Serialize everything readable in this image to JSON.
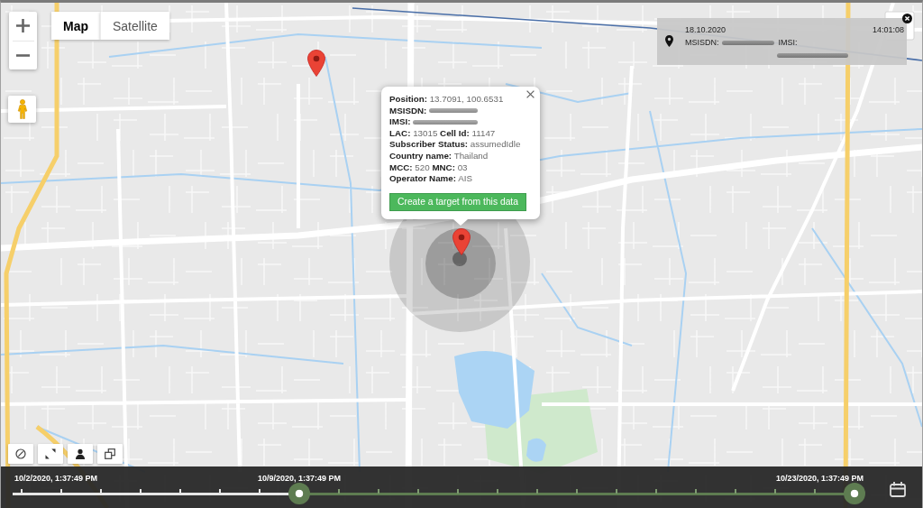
{
  "map": {
    "type_toggle": [
      {
        "label": "Map",
        "selected": true
      },
      {
        "label": "Satellite",
        "selected": false
      }
    ]
  },
  "popup": {
    "lines": [
      {
        "text": "**Position:** 13.7091, 100.6531",
        "redacted": false
      },
      {
        "text": "**MSISDN:**",
        "redacted": true
      },
      {
        "text": "**IMSI:**",
        "redacted": true
      },
      {
        "text": "**LAC:** 13015 **Cell Id:** 11147",
        "redacted": false
      },
      {
        "text": "**Subscriber Status:** assumedIdle",
        "redacted": false
      },
      {
        "text": "**Country name:** Thailand",
        "redacted": false
      },
      {
        "text": "**MCC:** 520 **MNC:** 03",
        "redacted": false
      },
      {
        "text": "**Operator Name:** AIS",
        "redacted": false
      }
    ],
    "button": "Create a target from this data"
  },
  "device_panel": {
    "date": "18.10.2020",
    "time": "14:01:08",
    "fields": [
      {
        "label": "MSISDN:",
        "redacted": true
      },
      {
        "label": "IMSI:",
        "redacted": true
      }
    ]
  },
  "timeline": {
    "start_label": "10/2/2020, 1:37:49 PM",
    "thumbs": [
      {
        "label": "10/9/2020, 1:37:49 PM",
        "level": 0.3333
      },
      {
        "label": "10/23/2020, 1:37:49 PM",
        "level": 1
      }
    ]
  }
}
